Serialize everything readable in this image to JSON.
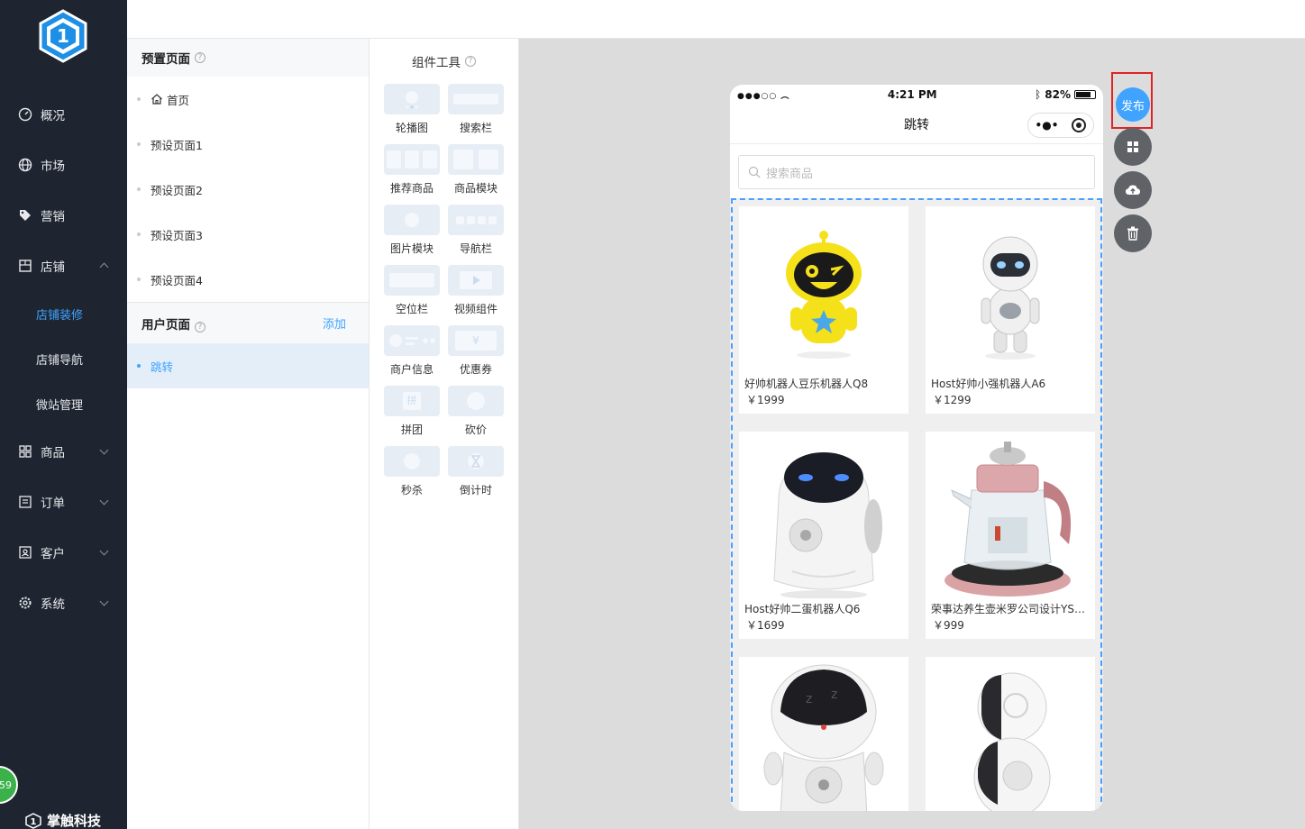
{
  "sidebar": {
    "menu": [
      {
        "label": "概况",
        "icon": "dashboard-icon"
      },
      {
        "label": "市场",
        "icon": "globe-icon"
      },
      {
        "label": "营销",
        "icon": "tag-icon"
      },
      {
        "label": "店铺",
        "icon": "store-icon"
      },
      {
        "label": "商品",
        "icon": "grid-icon"
      },
      {
        "label": "订单",
        "icon": "list-icon"
      },
      {
        "label": "客户",
        "icon": "contact-icon"
      },
      {
        "label": "系统",
        "icon": "gear-icon"
      }
    ],
    "store_sub": [
      "店铺装修",
      "店铺导航",
      "微站管理"
    ],
    "badge": "59",
    "brand": "掌触科技"
  },
  "pages_panel": {
    "preset_title": "预置页面",
    "preset_pages": [
      "首页",
      "预设页面1",
      "预设页面2",
      "预设页面3",
      "预设页面4"
    ],
    "user_title": "用户页面",
    "add_label": "添加",
    "user_pages": [
      "跳转"
    ]
  },
  "tools_panel": {
    "title": "组件工具",
    "tools": [
      "轮播图",
      "搜索栏",
      "推荐商品",
      "商品模块",
      "图片模块",
      "导航栏",
      "空位栏",
      "视频组件",
      "商户信息",
      "优惠券",
      "拼团",
      "砍价",
      "秒杀",
      "倒计时"
    ]
  },
  "phone": {
    "time": "4:21 PM",
    "battery": "82%",
    "title": "跳转",
    "search_placeholder": "搜索商品",
    "products": [
      {
        "name": "好帅机器人豆乐机器人Q8",
        "price": "￥1999"
      },
      {
        "name": "Host好帅小强机器人A6",
        "price": "￥1299"
      },
      {
        "name": "Host好帅二蛋机器人Q6",
        "price": "￥1699"
      },
      {
        "name": "荣事达养生壶米罗公司设计YSH...",
        "price": "￥999"
      },
      {
        "name": "",
        "price": ""
      },
      {
        "name": "",
        "price": ""
      }
    ]
  },
  "actions": {
    "publish_label": "发布",
    "buttons": [
      "grid-icon",
      "cloud-upload-icon",
      "trash-icon"
    ]
  },
  "colors": {
    "sidebar_bg": "#1f2530",
    "accent": "#3fa3ff",
    "highlight_frame": "#e02424"
  }
}
